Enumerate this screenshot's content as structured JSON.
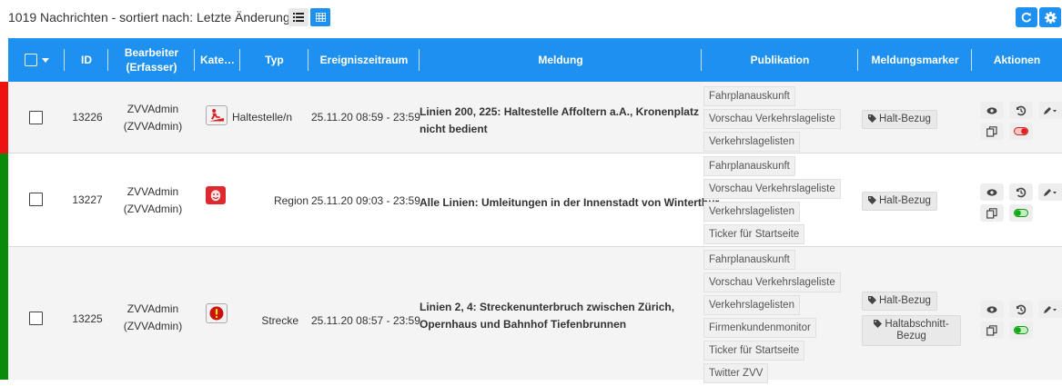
{
  "toolbar": {
    "count_title": "1019 Nachrichten - sortiert nach: Letzte Änderung",
    "list_view_icon": "list-view-icon",
    "grid_view_icon": "grid-view-icon",
    "refresh_icon": "refresh-icon",
    "settings_icon": "gear-icon"
  },
  "columns": {
    "id": "ID",
    "bearbeiter_line1": "Bearbeiter",
    "bearbeiter_line2": "(Erfasser)",
    "kategorie": "Kate…",
    "typ": "Typ",
    "zeitraum": "Ereigniszeitraum",
    "meldung": "Meldung",
    "publikation": "Publikation",
    "marker": "Meldungsmarker",
    "aktionen": "Aktionen"
  },
  "colors": {
    "accent": "#1e90ef",
    "status_red": "#ee1111",
    "status_green": "#0a8a0a"
  },
  "rows": [
    {
      "id": "13226",
      "user": "ZVVAdmin",
      "user_sub": "(ZVVAdmin)",
      "category_icon": "stop-person-icon",
      "typ": "Haltestelle/n",
      "zeit": "25.11.20 08:59 - 23:59",
      "meldung": "Linien 200, 225: Haltestelle Affoltern a.A., Kronenplatz nicht bedient",
      "status": "red",
      "publikation": [
        "Fahrplanauskunft",
        "Vorschau Verkehrslageliste",
        "Verkehrslagelisten"
      ],
      "marker": [
        "Halt-Bezug"
      ],
      "toggle": "off"
    },
    {
      "id": "13227",
      "user": "ZVVAdmin",
      "user_sub": "(ZVVAdmin)",
      "category_icon": "face-icon",
      "typ": "Region",
      "zeit": "25.11.20 09:03 - 23:59",
      "meldung": "Alle Linien: Umleitungen in der Innenstadt von Winterthur",
      "status": "green",
      "publikation": [
        "Fahrplanauskunft",
        "Vorschau Verkehrslageliste",
        "Verkehrslagelisten",
        "Ticker für Startseite"
      ],
      "marker": [
        "Halt-Bezug"
      ],
      "toggle": "on"
    },
    {
      "id": "13225",
      "user": "ZVVAdmin",
      "user_sub": "(ZVVAdmin)",
      "category_icon": "warning-icon",
      "typ": "Strecke",
      "zeit": "25.11.20 08:57 - 23:59",
      "meldung": "Linien 2, 4: Streckenunterbruch zwischen Zürich, Opernhaus und Bahnhof Tiefenbrunnen",
      "status": "green",
      "publikation": [
        "Fahrplanauskunft",
        "Vorschau Verkehrslageliste",
        "Verkehrslagelisten",
        "Firmenkundenmonitor",
        "Ticker für Startseite",
        "Twitter ZVV"
      ],
      "marker": [
        "Halt-Bezug",
        "Haltabschnitt-Bezug"
      ],
      "toggle": "on"
    }
  ]
}
